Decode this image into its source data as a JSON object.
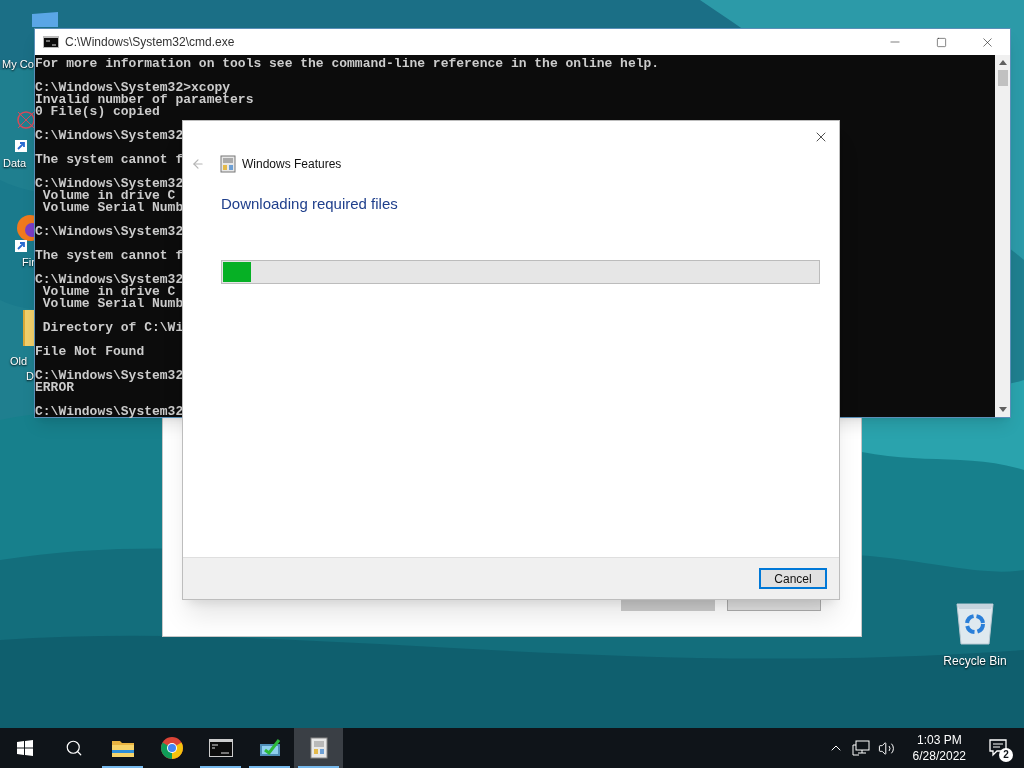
{
  "desktop": {
    "icons": [
      {
        "kind": "computer",
        "label_lines": [
          "My Co"
        ]
      },
      {
        "kind": "app",
        "label_lines": [
          "Data"
        ]
      },
      {
        "kind": "browser",
        "label_lines": [
          "Fir"
        ]
      },
      {
        "kind": "folder",
        "label_lines": [
          "Old",
          "D"
        ]
      },
      {
        "kind": "recycle",
        "label_lines": [
          "Recycle Bin"
        ]
      }
    ]
  },
  "cmd_window": {
    "title": "C:\\Windows\\System32\\cmd.exe",
    "blocks": [
      [
        "For more information on tools see the command-line reference in the online help."
      ],
      [
        "C:\\Windows\\System32>xcopy",
        "Invalid number of parameters",
        "0 File(s) copied"
      ],
      [
        "C:\\Windows\\System32"
      ],
      [
        "The system cannot f"
      ],
      [
        "C:\\Windows\\System32",
        " Volume in drive C",
        " Volume Serial Numb"
      ],
      [
        "C:\\Windows\\System32"
      ],
      [
        "The system cannot f"
      ],
      [
        "C:\\Windows\\System32",
        " Volume in drive C",
        " Volume Serial Numb"
      ],
      [
        " Directory of C:\\Wi"
      ],
      [
        "File Not Found"
      ],
      [
        "C:\\Windows\\System32",
        "ERROR"
      ],
      [
        "C:\\Windows\\System32"
      ]
    ]
  },
  "back_dialog": {
    "buttons": [
      {
        "disabled": true
      },
      {
        "disabled": false
      }
    ]
  },
  "features_dialog": {
    "title": "Windows Features",
    "heading": "Downloading required files",
    "progress": {
      "level": 0.047
    },
    "buttons": [
      "Cancel"
    ]
  },
  "taskbar": {
    "items": [
      {
        "kind": "start",
        "running": false,
        "selected": false
      },
      {
        "kind": "search",
        "running": false,
        "selected": false
      },
      {
        "kind": "explorer",
        "running": true,
        "selected": false
      },
      {
        "kind": "chrome",
        "running": false,
        "selected": false
      },
      {
        "kind": "cmd",
        "running": true,
        "selected": false
      },
      {
        "kind": "install",
        "running": true,
        "selected": false
      },
      {
        "kind": "features",
        "running": true,
        "selected": true
      }
    ],
    "time": "1:03 PM",
    "date": "6/28/2022",
    "notification_count": "2"
  }
}
